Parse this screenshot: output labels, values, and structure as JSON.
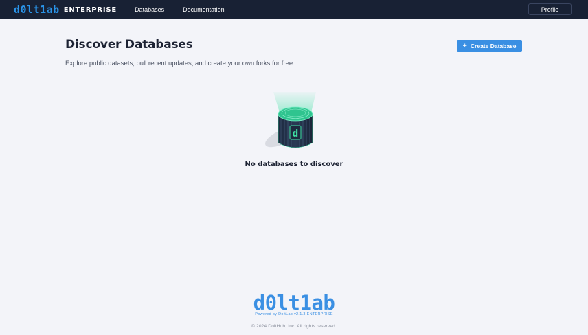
{
  "header": {
    "logo_text": "d0lt1ab",
    "edition": "ENTERPRISE",
    "nav": [
      {
        "label": "Databases"
      },
      {
        "label": "Documentation"
      }
    ],
    "profile_label": "Profile"
  },
  "main": {
    "title": "Discover Databases",
    "subtitle": "Explore public datasets, pull recent updates, and create your own forks for free.",
    "create_button": {
      "label": "Create Database",
      "icon": "plus-icon"
    },
    "empty_state": {
      "illustration_icon": "database-cylinder-icon",
      "message": "No databases to discover"
    }
  },
  "footer": {
    "logo_text": "d0lt1ab",
    "powered_by": "Powered by DoltLab v2.1.3 ENTERPRISE",
    "copyright": "© 2024 DoltHub, Inc. All rights reserved."
  },
  "colors": {
    "nav_bg": "#182134",
    "accent": "#3a8fe3",
    "page_bg": "#f3f4f9",
    "illustration_green": "#3ee0a3"
  }
}
